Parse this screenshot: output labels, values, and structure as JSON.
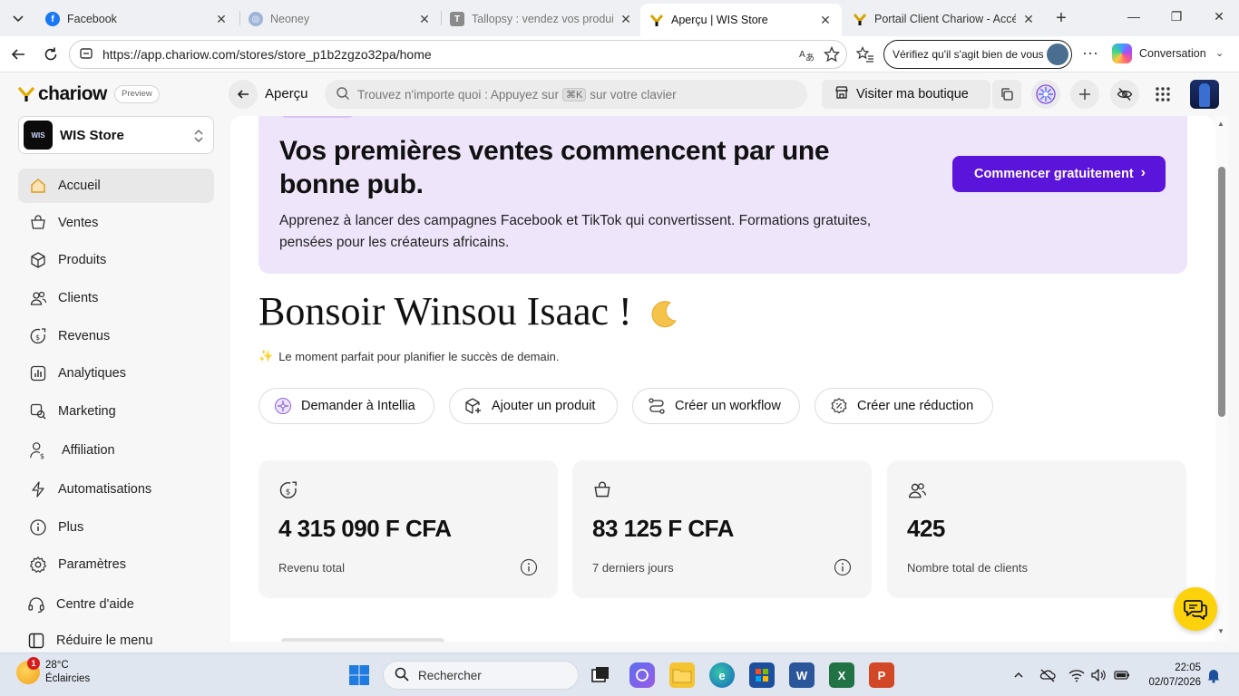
{
  "browser": {
    "tabs": [
      {
        "label": "Facebook",
        "state": "inactive-bold",
        "icon": "facebook-icon"
      },
      {
        "label": "Neoney",
        "state": "inactive",
        "icon": "neoney-icon"
      },
      {
        "label": "Tallopsy : vendez vos produits d",
        "state": "inactive",
        "icon": "tallopsy-icon"
      },
      {
        "label": "Aperçu | WIS Store",
        "state": "active",
        "icon": "chariow-icon"
      },
      {
        "label": "Portail Client Chariow - Accéde",
        "state": "inactive",
        "icon": "chariow-icon"
      }
    ],
    "url": "https://app.chariow.com/stores/store_p1b2zgzo32pa/home",
    "verify_label": "Vérifiez qu'il s'agit bien de vous",
    "copilot_label": "Conversation"
  },
  "header": {
    "brand": "chariow",
    "plan_badge": "Preview",
    "page_title": "Aperçu",
    "search_prefix": "Trouvez n'importe quoi : Appuyez sur",
    "search_key": "⌘K",
    "search_suffix": "sur votre clavier",
    "visit_label": "Visiter ma boutique"
  },
  "sidebar": {
    "store_name": "WIS Store",
    "store_logo_text": "WIS",
    "items": [
      {
        "label": "Accueil",
        "icon": "home-icon",
        "active": true
      },
      {
        "label": "Ventes",
        "icon": "cart-icon"
      },
      {
        "label": "Produits",
        "icon": "box-icon"
      },
      {
        "label": "Clients",
        "icon": "users-icon"
      },
      {
        "label": "Revenus",
        "icon": "revenue-icon"
      },
      {
        "label": "Analytiques",
        "icon": "analytics-icon"
      },
      {
        "label": "Marketing",
        "icon": "marketing-icon"
      },
      {
        "label": "Affiliation",
        "icon": "affiliation-icon"
      },
      {
        "label": "Automatisations",
        "icon": "bolt-icon"
      },
      {
        "label": "Plus",
        "icon": "info-icon"
      },
      {
        "label": "Paramètres",
        "icon": "gear-icon"
      },
      {
        "label": "Centre d'aide",
        "icon": "headset-icon"
      },
      {
        "label": "Réduire le menu",
        "icon": "collapse-icon"
      }
    ]
  },
  "promo": {
    "title": "Vos premières ventes commencent par une bonne pub.",
    "description": "Apprenez à lancer des campagnes Facebook et TikTok qui convertissent. Formations gratuites, pensées pour les créateurs africains.",
    "cta": "Commencer gratuitement"
  },
  "greeting": {
    "title": "Bonsoir Winsou Isaac !",
    "subtitle": "Le moment parfait pour planifier le succès de demain."
  },
  "quick_actions": [
    {
      "label": "Demander à Intellia",
      "icon": "intellia-icon"
    },
    {
      "label": "Ajouter un produit",
      "icon": "add-product-icon"
    },
    {
      "label": "Créer un workflow",
      "icon": "workflow-icon"
    },
    {
      "label": "Créer une réduction",
      "icon": "discount-icon"
    }
  ],
  "stats": [
    {
      "value": "4 315 090 F CFA",
      "label": "Revenu total",
      "icon": "revenue-icon"
    },
    {
      "value": "83 125 F CFA",
      "label": "7 derniers jours",
      "icon": "cart-icon"
    },
    {
      "value": "425",
      "label": "Nombre total de clients",
      "icon": "users-icon"
    }
  ],
  "taskbar": {
    "temperature": "28°C",
    "weather": "Éclaircies",
    "notification_count": "1",
    "search_label": "Rechercher",
    "time": "22:05",
    "date": "02/07/2026"
  },
  "colors": {
    "accent": "#5b14d9",
    "promo_bg": "#efe5fb",
    "chat_button": "#fcd20c",
    "active_nav": "#e8e8e8"
  }
}
